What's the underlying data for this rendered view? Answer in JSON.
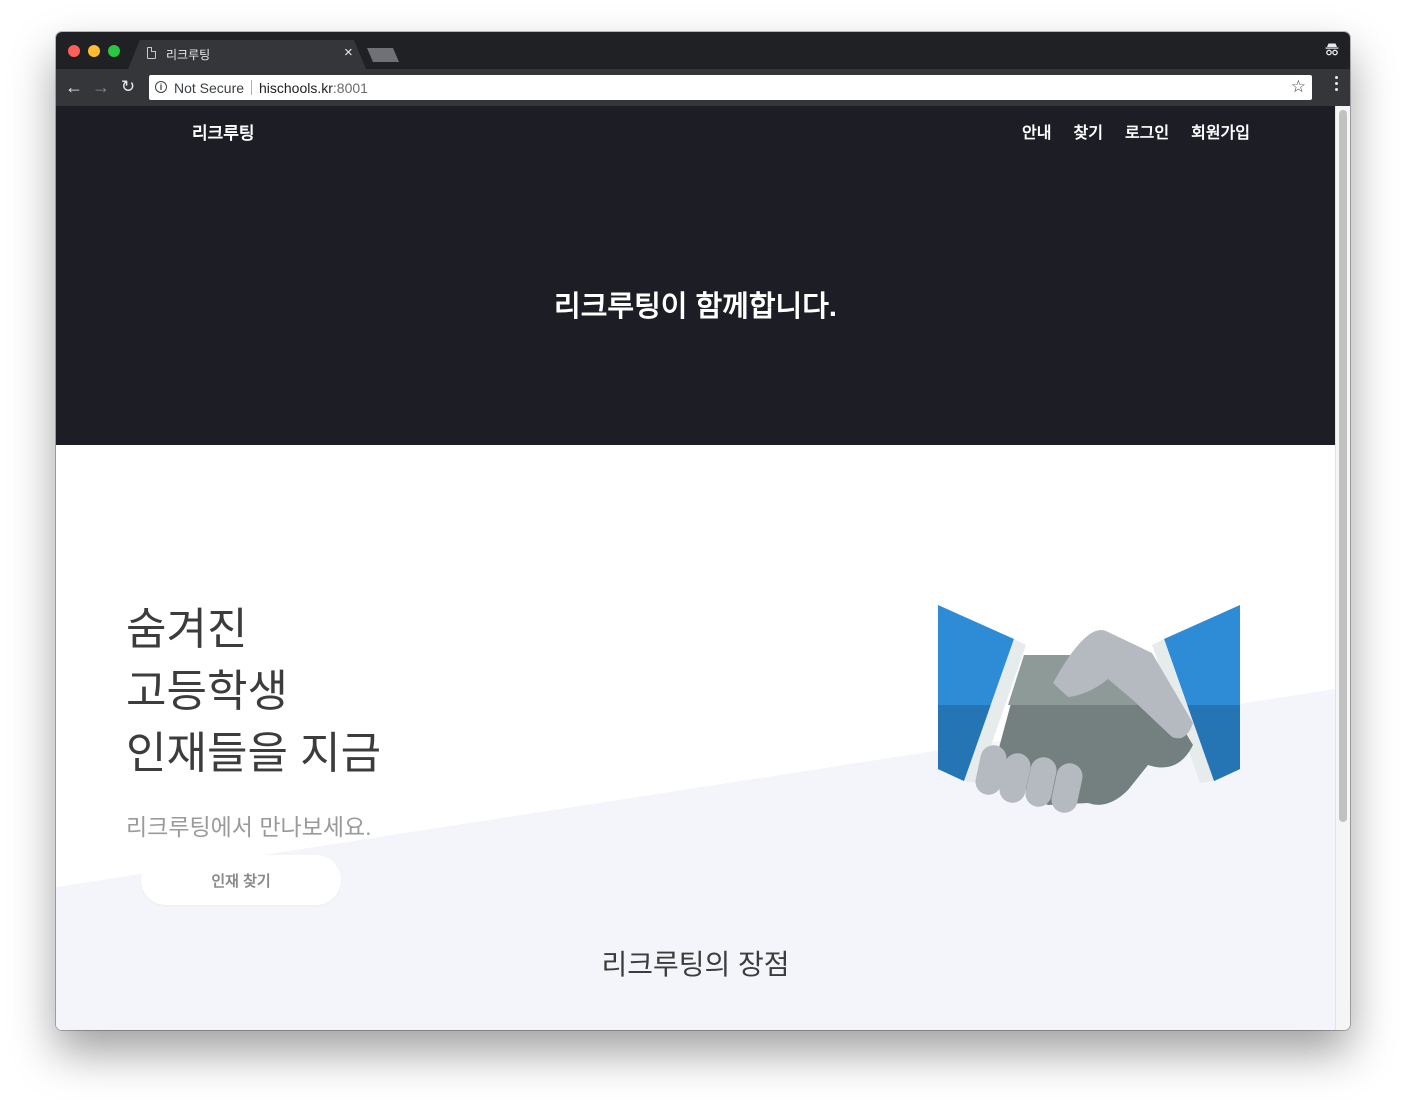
{
  "browser": {
    "tab_title": "리크루팅",
    "tab_close": "×",
    "security_label": "Not Secure",
    "url_host": "hischools.kr",
    "url_port": ":8001"
  },
  "site": {
    "brand": "리크루팅",
    "nav": [
      "안내",
      "찾기",
      "로그인",
      "회원가입"
    ],
    "hero_title": "리크루팅이 함께합니다."
  },
  "main": {
    "headline_lines": [
      "숨겨진",
      "고등학생",
      "인재들을 지금"
    ],
    "subline": "리크루팅에서 만나보세요.",
    "cta_label": "인재 찾기",
    "section_title": "리크루팅의 장점"
  },
  "colors": {
    "hero_bg": "#1c1d25",
    "slant_bg": "#f4f5fa",
    "cuff_blue": "#2e8bd6",
    "cuff_blue_dark": "#2574b4"
  }
}
